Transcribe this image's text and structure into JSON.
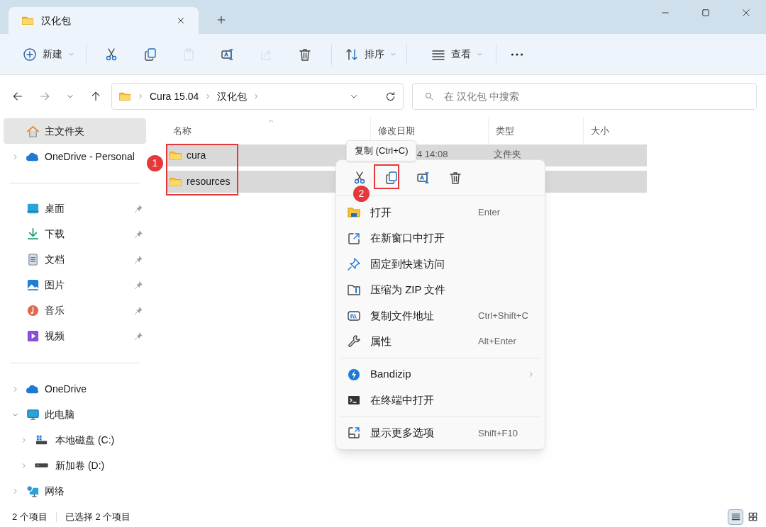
{
  "window": {
    "tabs": [
      {
        "label": "汉化包",
        "selected": true
      }
    ]
  },
  "toolbar": {
    "items": [
      {
        "kind": "new",
        "label": "新建",
        "disabled": false
      },
      {
        "kind": "cut",
        "disabled": false
      },
      {
        "kind": "copy",
        "disabled": false
      },
      {
        "kind": "paste",
        "disabled": true
      },
      {
        "kind": "rename",
        "disabled": false
      },
      {
        "kind": "share",
        "disabled": true
      },
      {
        "kind": "delete",
        "disabled": false
      },
      {
        "kind": "sort",
        "label": "排序",
        "disabled": false
      },
      {
        "kind": "view",
        "label": "查看",
        "disabled": false
      },
      {
        "kind": "more",
        "disabled": false
      }
    ]
  },
  "address": {
    "breadcrumbs": [
      "Cura 15.04",
      "汉化包"
    ],
    "search_placeholder": "在 汉化包 中搜索"
  },
  "sidebar": {
    "groups": [
      [
        {
          "label": "主文件夹",
          "selected": true
        },
        {
          "label": "OneDrive - Personal",
          "selected": false,
          "expanded": false
        }
      ],
      [
        {
          "label": "桌面",
          "selected": false,
          "pinned": true
        },
        {
          "label": "下载",
          "selected": false,
          "pinned": true
        },
        {
          "label": "文档",
          "selected": false,
          "pinned": true
        },
        {
          "label": "图片",
          "selected": false,
          "pinned": true
        },
        {
          "label": "音乐",
          "selected": false,
          "pinned": true
        },
        {
          "label": "视频",
          "selected": false,
          "pinned": true
        }
      ],
      [
        {
          "label": "OneDrive",
          "selected": false,
          "expanded": false
        },
        {
          "label": "此电脑",
          "selected": false,
          "expanded": true,
          "children": [
            {
              "label": "本地磁盘 (C:)",
              "selected": false,
              "expanded": false
            },
            {
              "label": "新加卷 (D:)",
              "selected": false,
              "expanded": false
            }
          ]
        },
        {
          "label": "网络",
          "selected": false,
          "expanded": false
        }
      ]
    ]
  },
  "table": {
    "columns": [
      {
        "label": "名称",
        "sorted": true
      },
      {
        "label": "修改日期",
        "sorted": false
      },
      {
        "label": "类型",
        "sorted": false
      },
      {
        "label": "大小",
        "sorted": false
      }
    ],
    "rows": [
      {
        "name": "cura",
        "date": "4 14:08",
        "type": "文件夹",
        "selected": true
      },
      {
        "name": "resources",
        "selected": true
      }
    ]
  },
  "tooltip": "复制 (Ctrl+C)",
  "context_menu": {
    "quick_actions": [
      {
        "kind": "cut"
      },
      {
        "kind": "copy"
      },
      {
        "kind": "rename"
      },
      {
        "kind": "delete"
      }
    ],
    "items": [
      {
        "kind": "item",
        "label": "打开",
        "shortcut": "Enter"
      },
      {
        "kind": "item",
        "label": "在新窗口中打开"
      },
      {
        "kind": "item",
        "label": "固定到快速访问"
      },
      {
        "kind": "item",
        "label": "压缩为 ZIP 文件"
      },
      {
        "kind": "item",
        "label": "复制文件地址",
        "shortcut": "Ctrl+Shift+C"
      },
      {
        "kind": "item",
        "label": "属性",
        "shortcut": "Alt+Enter"
      },
      {
        "kind": "separator"
      },
      {
        "kind": "item",
        "label": "Bandizip",
        "submenu": true
      },
      {
        "kind": "item",
        "label": "在终端中打开"
      },
      {
        "kind": "separator"
      },
      {
        "kind": "item",
        "label": "显示更多选项",
        "shortcut": "Shift+F10"
      }
    ]
  },
  "annotations": [
    {
      "label": "1"
    },
    {
      "label": "2"
    }
  ],
  "status_bar": {
    "texts": [
      "2 个项目",
      "已选择 2 个项目"
    ],
    "views": [
      {
        "kind": "details",
        "selected": true
      },
      {
        "kind": "tiles",
        "selected": false
      }
    ]
  }
}
